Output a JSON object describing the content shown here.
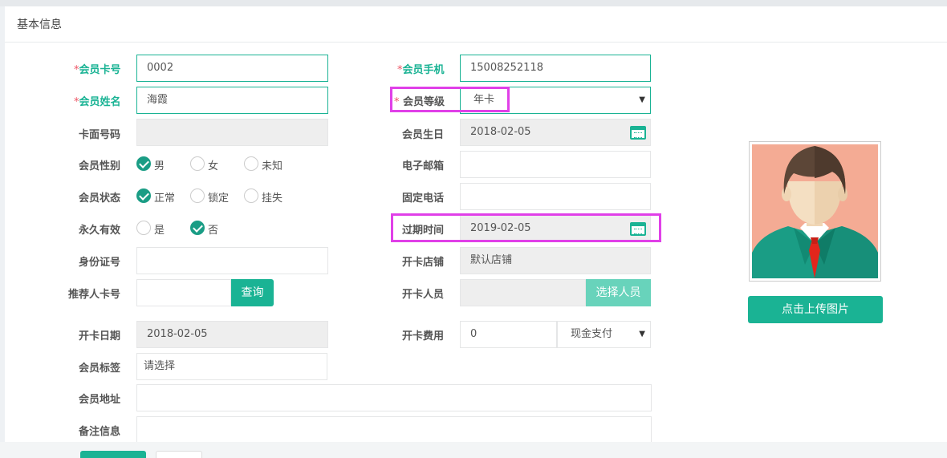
{
  "panel": {
    "title": "基本信息"
  },
  "labels": {
    "card_no": "会员卡号",
    "name": "会员姓名",
    "face_no": "卡面号码",
    "gender": "会员性别",
    "status": "会员状态",
    "permanent": "永久有效",
    "id_no": "身份证号",
    "referrer": "推荐人卡号",
    "open_date": "开卡日期",
    "tags": "会员标签",
    "address": "会员地址",
    "remark": "备注信息",
    "phone": "会员手机",
    "level": "会员等级",
    "birthday": "会员生日",
    "email": "电子邮箱",
    "tel": "固定电话",
    "expire": "过期时间",
    "store": "开卡店铺",
    "staff": "开卡人员",
    "fee": "开卡费用"
  },
  "required_mark": "*",
  "values": {
    "card_no": "0002",
    "name": "海霞",
    "face_no": "",
    "id_no": "",
    "referrer": "",
    "open_date": "2018-02-05",
    "tags": "请选择",
    "address": "",
    "remark": "",
    "phone": "15008252118",
    "level": "年卡",
    "birthday": "2018-02-05",
    "email": "",
    "tel": "",
    "expire": "2019-02-05",
    "store": "默认店铺",
    "staff": "",
    "fee": "0",
    "pay_method": "现金支付"
  },
  "options": {
    "gender": [
      "男",
      "女",
      "未知"
    ],
    "gender_selected": "男",
    "status": [
      "正常",
      "锁定",
      "挂失"
    ],
    "status_selected": "正常",
    "permanent": [
      "是",
      "否"
    ],
    "permanent_selected": "否"
  },
  "buttons": {
    "query": "查询",
    "choose_staff": "选择人员",
    "upload": "点击上传图片"
  },
  "icons": {
    "calendar": "calendar-icon",
    "dropdown": "chevron-down-icon",
    "avatar": "avatar-placeholder"
  },
  "colors": {
    "accent": "#1ab394",
    "required_star": "#ed5565",
    "highlight": "#e040e8"
  }
}
